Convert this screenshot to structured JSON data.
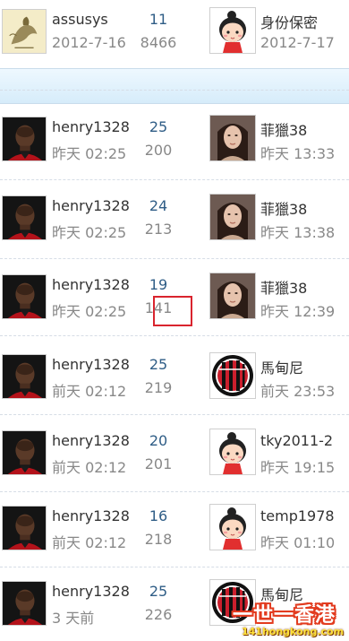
{
  "rows": [
    {
      "author": "assusys",
      "author_time": "2012-7-16",
      "replies": "11",
      "views": "8466",
      "last_poster": "身份保密",
      "last_time": "2012-7-17",
      "author_avatar": "sketch-avatar-icon",
      "last_avatar": "cartoon-girl-avatar-icon"
    },
    {
      "author": "henry1328",
      "author_time": "昨天 02:25",
      "replies": "25",
      "views": "200",
      "last_poster": "菲獵38",
      "last_time": "昨天 13:33",
      "author_avatar": "man-photo-avatar-icon",
      "last_avatar": "woman-photo-avatar-icon"
    },
    {
      "author": "henry1328",
      "author_time": "昨天 02:25",
      "replies": "24",
      "views": "213",
      "last_poster": "菲獵38",
      "last_time": "昨天 13:38",
      "author_avatar": "man-photo-avatar-icon",
      "last_avatar": "woman-photo-avatar-icon"
    },
    {
      "author": "henry1328",
      "author_time": "昨天 02:25",
      "replies": "19",
      "views": "141",
      "last_poster": "菲獵38",
      "last_time": "昨天 12:39",
      "author_avatar": "man-photo-avatar-icon",
      "last_avatar": "woman-photo-avatar-icon",
      "highlight": true
    },
    {
      "author": "henry1328",
      "author_time": "前天 02:12",
      "replies": "25",
      "views": "219",
      "last_poster": "馬甸尼",
      "last_time": "前天 23:53",
      "author_avatar": "man-photo-avatar-icon",
      "last_avatar": "ac-milan-badge-icon"
    },
    {
      "author": "henry1328",
      "author_time": "前天 02:12",
      "replies": "20",
      "views": "201",
      "last_poster": "tky2011-2",
      "last_time": "昨天 19:15",
      "author_avatar": "man-photo-avatar-icon",
      "last_avatar": "cartoon-girl-avatar-icon"
    },
    {
      "author": "henry1328",
      "author_time": "前天 02:12",
      "replies": "16",
      "views": "218",
      "last_poster": "temp1978",
      "last_time": "昨天 01:10",
      "author_avatar": "man-photo-avatar-icon",
      "last_avatar": "cartoon-girl-avatar-icon"
    },
    {
      "author": "henry1328",
      "author_time": "3 天前",
      "replies": "25",
      "views": "226",
      "last_poster": "馬甸尼",
      "last_time": "",
      "author_avatar": "man-photo-avatar-icon",
      "last_avatar": "ac-milan-badge-icon"
    }
  ],
  "watermark": {
    "line1": "一世一香港",
    "line2": "141hongkong.com"
  },
  "colors": {
    "replies": "#2f5d86",
    "muted": "#888888",
    "highlight": "#d9242e",
    "category_bar": "#d6ecfa"
  }
}
